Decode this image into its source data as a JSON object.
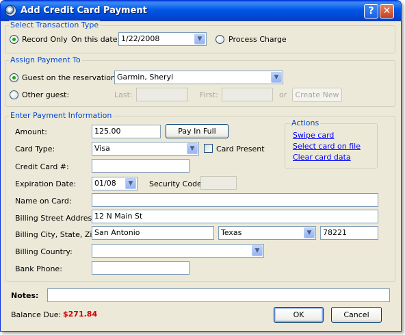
{
  "window": {
    "title": "Add Credit Card Payment",
    "help_label": "?",
    "close_label": "✕"
  },
  "transaction": {
    "group_label": "Select Transaction Type",
    "record_only_label": "Record Only",
    "record_only_selected": true,
    "on_date_label": "On this date:",
    "date_value": "1/22/2008",
    "process_charge_label": "Process Charge",
    "process_charge_selected": false
  },
  "assign": {
    "group_label": "Assign Payment To",
    "guest_label": "Guest on the reservation:",
    "guest_selected": true,
    "guest_value": "Garmin, Sheryl",
    "other_label": "Other guest:",
    "other_selected": false,
    "last_label": "Last:",
    "last_value": "",
    "first_label": "First:",
    "first_value": "",
    "or_label": "or",
    "create_new_label": "Create New"
  },
  "payment": {
    "group_label": "Enter Payment Information",
    "amount_label": "Amount:",
    "amount_value": "125.00",
    "pay_in_full_label": "Pay In Full",
    "card_type_label": "Card Type:",
    "card_type_value": "Visa",
    "card_present_label": "Card Present",
    "card_present_checked": false,
    "cc_number_label": "Credit Card #:",
    "cc_number_value": "",
    "expiration_label": "Expiration Date:",
    "expiration_value": "01/08",
    "security_label": "Security Code:",
    "security_value": "",
    "name_label": "Name on Card:",
    "name_value": "",
    "street_label": "Billing Street Address:",
    "street_value": "12 N Main St",
    "city_label": "Billing City, State, Zip:",
    "city_value": "San Antonio",
    "state_value": "Texas",
    "zip_value": "78221",
    "country_label": "Billing Country:",
    "country_value": "",
    "phone_label": "Bank Phone:",
    "phone_value": ""
  },
  "actions": {
    "label": "Actions",
    "swipe": "Swipe card",
    "select_on_file": "Select card on file",
    "clear": "Clear card data"
  },
  "footer": {
    "notes_label": "Notes:",
    "notes_value": "",
    "balance_label": "Balance Due:",
    "balance_value": "$271.84",
    "ok_label": "OK",
    "cancel_label": "Cancel"
  },
  "colors": {
    "title_bar": "#0055E5",
    "group_label": "#0046D5",
    "balance": "#CC0000",
    "link": "#0000FF",
    "dialog_bg": "#ECE9D8"
  }
}
